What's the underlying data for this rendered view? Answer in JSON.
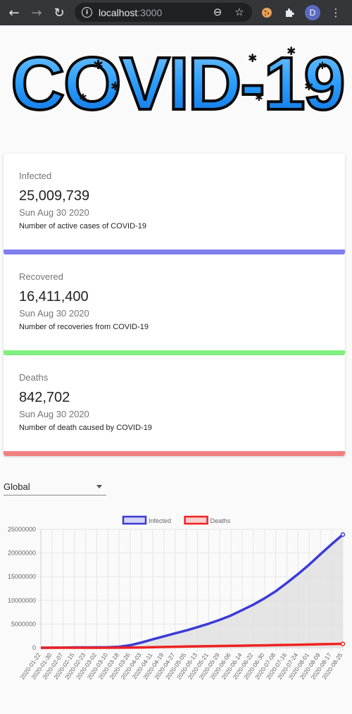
{
  "browser": {
    "url_host": "localhost",
    "url_port": ":3000",
    "profile_initial": "D"
  },
  "header": {
    "logo_text": "COVID-19",
    "logo_color": "#1e90ff"
  },
  "cards": [
    {
      "label": "Infected",
      "value": "25,009,739",
      "date": "Sun Aug 30 2020",
      "description": "Number of active cases of COVID-19",
      "color": "#8080f0"
    },
    {
      "label": "Recovered",
      "value": "16,411,400",
      "date": "Sun Aug 30 2020",
      "description": "Number of recoveries from COVID-19",
      "color": "#80f080"
    },
    {
      "label": "Deaths",
      "value": "842,702",
      "date": "Sun Aug 30 2020",
      "description": "Number of death caused by COVID-19",
      "color": "#f08080"
    }
  ],
  "selector": {
    "selected": "Global"
  },
  "chart_data": {
    "type": "line",
    "legend_position": "top",
    "grid": true,
    "ylim": [
      0,
      25000000
    ],
    "yticks": [
      0,
      5000000,
      10000000,
      15000000,
      20000000,
      25000000
    ],
    "x_tick_labels": [
      "2020-01-22",
      "2020-01-30",
      "2020-02-07",
      "2020-02-15",
      "2020-02-23",
      "2020-03-02",
      "2020-03-10",
      "2020-03-18",
      "2020-03-26",
      "2020-04-03",
      "2020-04-11",
      "2020-04-19",
      "2020-04-27",
      "2020-05-05",
      "2020-05-13",
      "2020-05-21",
      "2020-05-29",
      "2020-06-06",
      "2020-06-14",
      "2020-06-22",
      "2020-06-30",
      "2020-07-08",
      "2020-07-16",
      "2020-07-24",
      "2020-08-01",
      "2020-08-09",
      "2020-08-17",
      "2020-08-25"
    ],
    "series": [
      {
        "name": "Infected",
        "color": "#3b3bd6",
        "fill": "#e0e0e0",
        "values": [
          555,
          9900,
          31400,
          69000,
          79000,
          90000,
          119000,
          214000,
          530000,
          1100000,
          1770000,
          2410000,
          3040000,
          3660000,
          4350000,
          5070000,
          5890000,
          6820000,
          7940000,
          9110000,
          10450000,
          11930000,
          13700000,
          15570000,
          17580000,
          19740000,
          21860000,
          23900000
        ]
      },
      {
        "name": "Deaths",
        "color": "#ee2222",
        "values": [
          17,
          213,
          720,
          1670,
          2470,
          3110,
          4270,
          9000,
          26500,
          59000,
          108000,
          166000,
          211000,
          252000,
          298000,
          330000,
          367000,
          404000,
          434000,
          470000,
          510000,
          548000,
          589000,
          638000,
          691000,
          739000,
          783000,
          826000
        ]
      }
    ]
  }
}
